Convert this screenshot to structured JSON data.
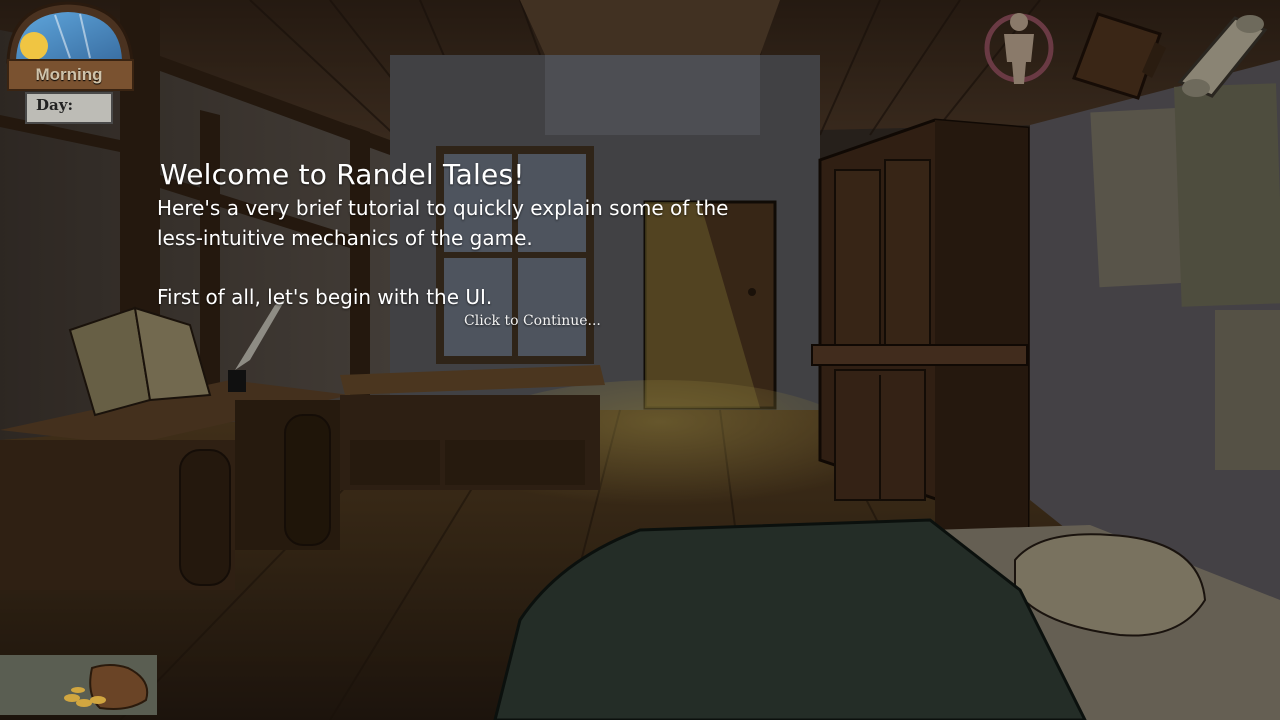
{
  "time_widget": {
    "period": "Morning",
    "day_label": "Day:"
  },
  "tutorial": {
    "title": "Welcome to Randel Tales!",
    "body": "Here's a very brief tutorial to quickly explain some of the\nless-intuitive mechanics of the game.\n\nFirst of all, let's begin with the UI.",
    "continue": "Click to Continue..."
  },
  "top_icons": [
    "character-icon",
    "journal-icon",
    "map-scroll-icon"
  ],
  "bottom_icons": [
    "coin-pouch-icon"
  ],
  "colors": {
    "sky": "#4f8fc8",
    "sun": "#f0c542",
    "wood": "#5a3a22",
    "overlay": "#000000"
  }
}
